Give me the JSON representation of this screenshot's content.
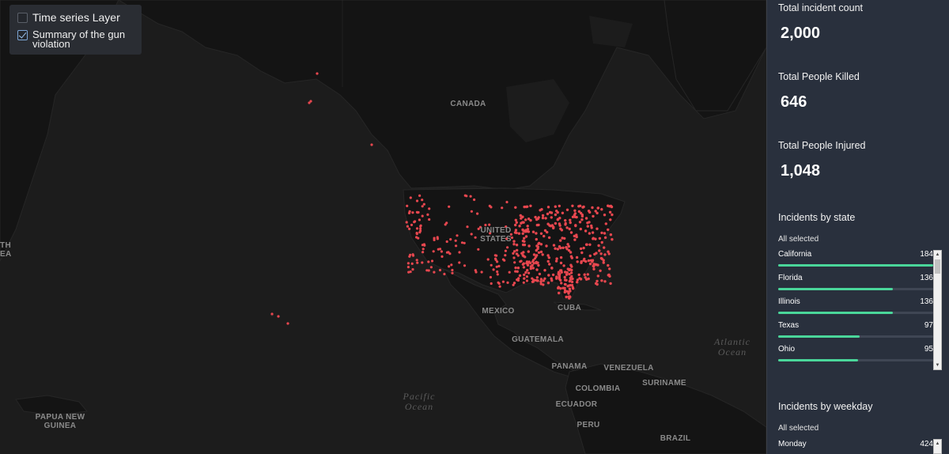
{
  "layers": {
    "items": [
      {
        "label": "Time series Layer",
        "checked": false
      },
      {
        "label": "Summary of the gun violation",
        "checked": true
      }
    ]
  },
  "map": {
    "country_labels": {
      "canada": "CANADA",
      "united_states": "UNITED STATES",
      "mexico": "MEXICO",
      "cuba": "CUBA",
      "guatemala": "GUATEMALA",
      "panama": "PANAMA",
      "venezuela": "VENEZUELA",
      "colombia": "COLOMBIA",
      "suriname": "SURINAME",
      "ecuador": "ECUADOR",
      "peru": "PERU",
      "brazil": "BRAZIL",
      "papua_new_guinea": "PAPUA NEW GUINEA",
      "partial_left": "TH EA"
    },
    "ocean_labels": {
      "pacific": "Pacific Ocean",
      "atlantic": "Atlantic Ocean"
    },
    "point_color": "#e8474f",
    "land_color": "#141414",
    "water_color": "#1c1c1c"
  },
  "stats": {
    "incident_count": {
      "title": "Total incident count",
      "value": "2,000"
    },
    "people_killed": {
      "title": "Total People Killed",
      "value": "646"
    },
    "people_injured": {
      "title": "Total People Injured",
      "value": "1,048"
    }
  },
  "by_state": {
    "title": "Incidents by state",
    "all_selected": "All selected",
    "items": [
      {
        "name": "California",
        "count": "184",
        "fraction": 1.0
      },
      {
        "name": "Florida",
        "count": "136",
        "fraction": 0.74
      },
      {
        "name": "Illinois",
        "count": "136",
        "fraction": 0.74
      },
      {
        "name": "Texas",
        "count": "97",
        "fraction": 0.527
      },
      {
        "name": "Ohio",
        "count": "95",
        "fraction": 0.516
      }
    ]
  },
  "by_weekday": {
    "title": "Incidents by weekday",
    "all_selected": "All selected",
    "items": [
      {
        "name": "Monday",
        "count": "424"
      }
    ]
  },
  "colors": {
    "bar_fill": "#4ad69a",
    "sidebar_bg": "#29303d"
  }
}
